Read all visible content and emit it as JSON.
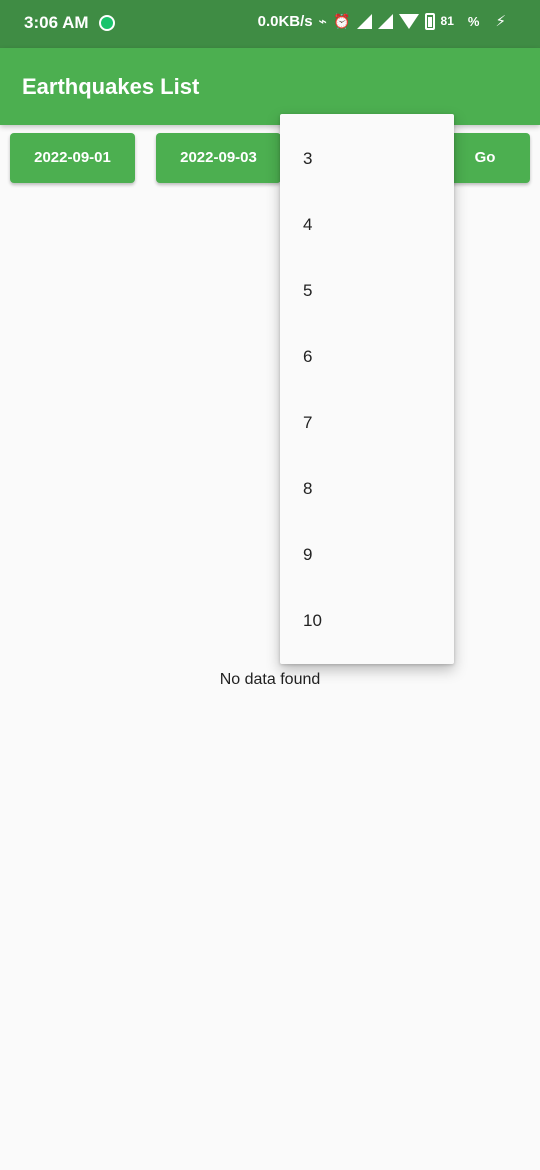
{
  "status_bar": {
    "time": "3:06 AM",
    "network_speed": "0.0KB/s",
    "battery_level": "81",
    "battery_suffix": "%"
  },
  "app_bar": {
    "title": "Earthquakes List"
  },
  "buttons": {
    "start_date": "2022-09-01",
    "end_date": "2022-09-03",
    "go": "Go"
  },
  "dropdown": {
    "options": [
      "3",
      "4",
      "5",
      "6",
      "7",
      "8",
      "9",
      "10"
    ]
  },
  "main": {
    "empty_message": "No data found"
  }
}
